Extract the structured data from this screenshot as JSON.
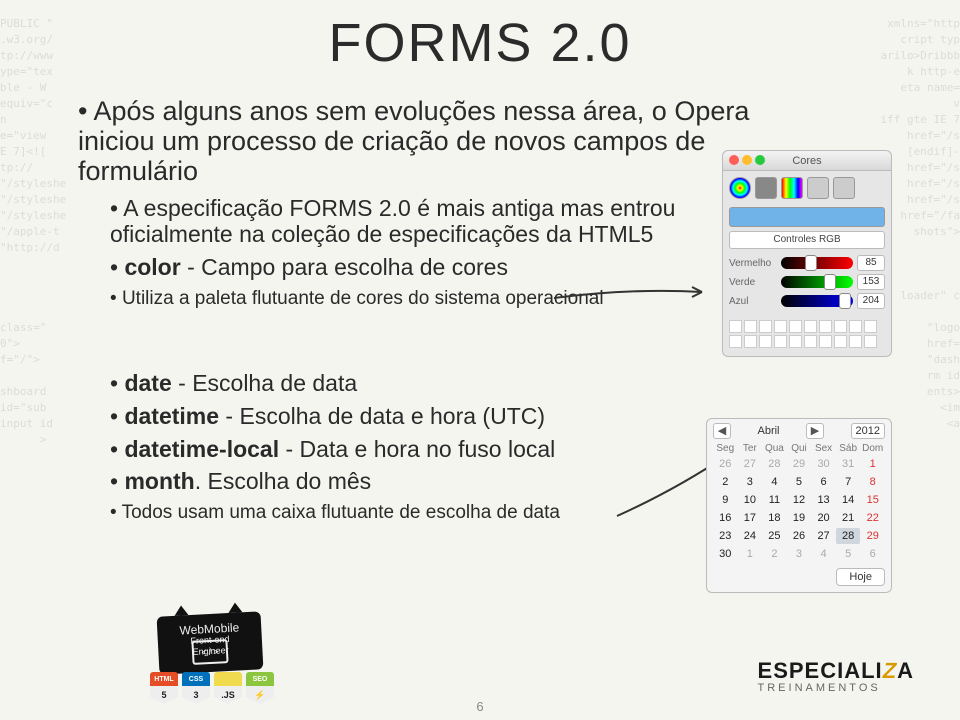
{
  "title": "FORMS 2.0",
  "bullets": {
    "main": "Após alguns anos sem evoluções nessa área, o Opera iniciou um processo de criação de novos campos de formulário",
    "spec": "A especificação FORMS 2.0 é mais antiga mas entrou oficialmente na coleção de especificações da HTML5",
    "color_label": "color",
    "color_desc": " - Campo para escolha de cores",
    "color_sub": "Utiliza a paleta flutuante de cores do sistema operacional",
    "date_label": "date",
    "date_desc": " - Escolha de data",
    "datetime_label": "datetime",
    "datetime_desc": " - Escolha de data e hora (UTC)",
    "datetimelocal_label": "datetime-local",
    "datetimelocal_desc": " - Data e hora no fuso local",
    "month_label": "month",
    "month_desc": ". Escolha do mês",
    "month_sub": "Todos usam uma caixa flutuante de escolha de data"
  },
  "color_panel": {
    "title": "Cores",
    "mode": "Controles RGB",
    "sliders": {
      "r": {
        "label": "Vermelho",
        "value": "85"
      },
      "g": {
        "label": "Verde",
        "value": "153"
      },
      "b": {
        "label": "Azul",
        "value": "204"
      }
    }
  },
  "date_panel": {
    "month": "Abril",
    "year": "2012",
    "prev": "◀",
    "next": "▶",
    "dow": [
      "Seg",
      "Ter",
      "Qua",
      "Qui",
      "Sex",
      "Sáb",
      "Dom"
    ],
    "today": "Hoje"
  },
  "page_number": "6",
  "footer_badge": {
    "line1": "WebMobile",
    "line2": "Front-end",
    "line3": "Engineer"
  },
  "shields": [
    "HTML",
    "CSS",
    ".JS",
    "SEO"
  ],
  "logo": {
    "brand_pre": "ESPECIALI",
    "brand_z": "Z",
    "brand_post": "A",
    "sub": "TREINAMENTOS"
  }
}
